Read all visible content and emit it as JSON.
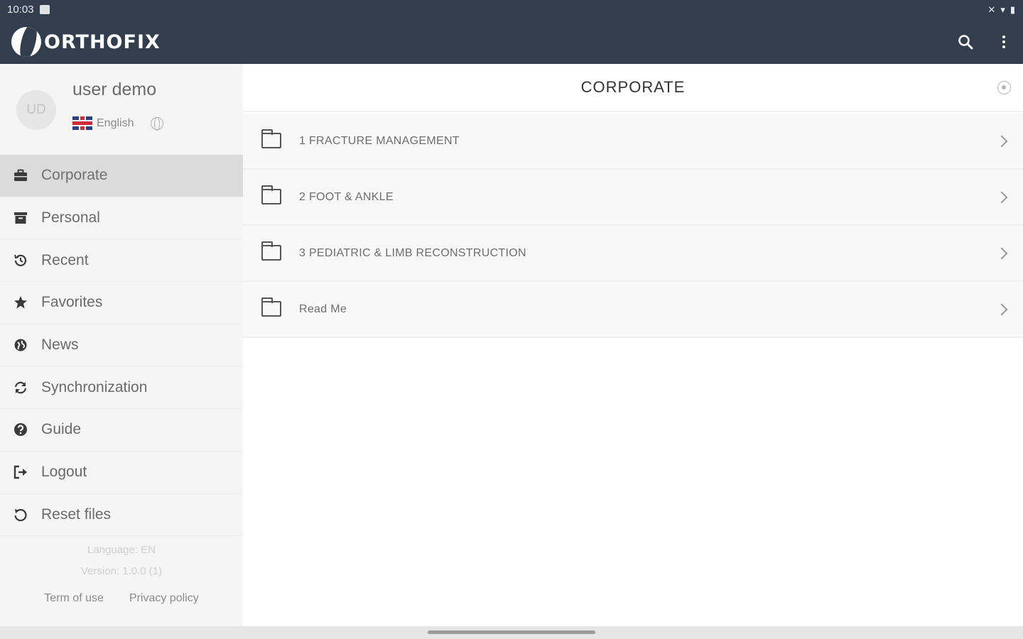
{
  "status_bar": {
    "time": "10:03"
  },
  "header": {
    "logo_text": "ORTHOFIX",
    "search_icon": "search-icon",
    "more_icon": "more-vert-icon",
    "bg_color": "#323d4d"
  },
  "user": {
    "initials": "UD",
    "name": "user demo",
    "language": "English"
  },
  "sidebar": {
    "items": [
      {
        "label": "Corporate",
        "icon": "briefcase-icon",
        "active": true
      },
      {
        "label": "Personal",
        "icon": "archive-icon",
        "active": false
      },
      {
        "label": "Recent",
        "icon": "history-icon",
        "active": false
      },
      {
        "label": "Favorites",
        "icon": "star-icon",
        "active": false
      },
      {
        "label": "News",
        "icon": "globe-icon",
        "active": false
      },
      {
        "label": "Synchronization",
        "icon": "sync-icon",
        "active": false
      },
      {
        "label": "Guide",
        "icon": "help-icon",
        "active": false
      },
      {
        "label": "Logout",
        "icon": "logout-icon",
        "active": false
      },
      {
        "label": "Reset files",
        "icon": "reset-icon",
        "active": false
      }
    ],
    "footer": {
      "language": "Language: EN",
      "version": "Version: 1.0.0 (1)",
      "terms": "Term of use",
      "privacy": "Privacy policy"
    }
  },
  "main": {
    "title": "CORPORATE",
    "folders": [
      {
        "label": "1 FRACTURE MANAGEMENT"
      },
      {
        "label": "2 FOOT & ANKLE"
      },
      {
        "label": "3 PEDIATRIC & LIMB RECONSTRUCTION"
      },
      {
        "label": "Read Me"
      }
    ]
  }
}
